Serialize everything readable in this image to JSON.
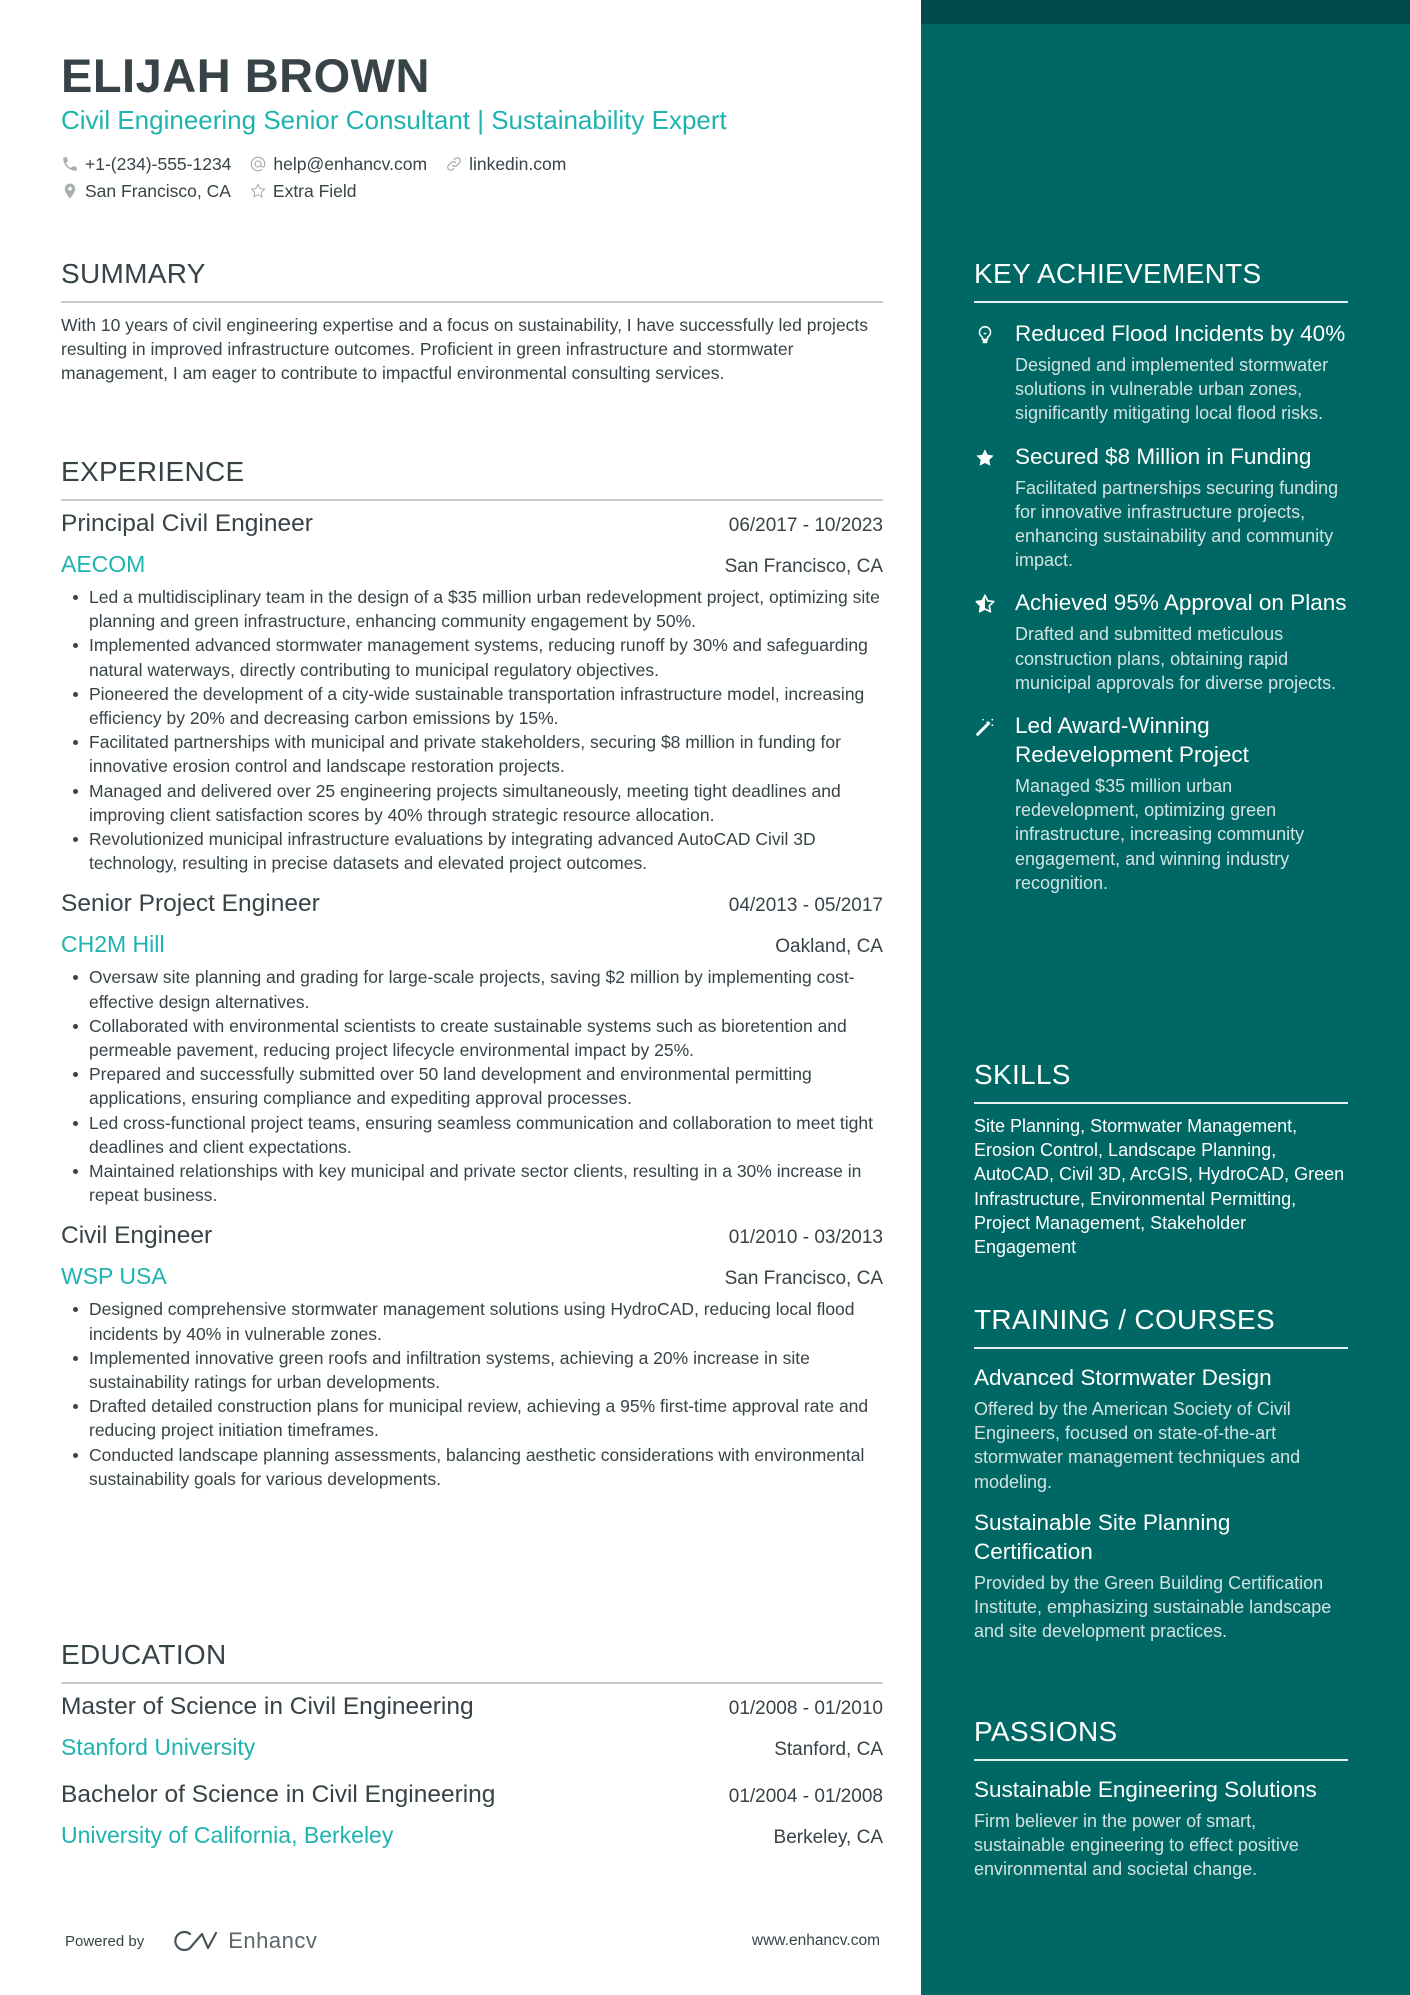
{
  "header": {
    "name": "ELIJAH BROWN",
    "subtitle": "Civil Engineering Senior Consultant | Sustainability Expert",
    "contacts": [
      {
        "icon": "phone-icon",
        "text": "+1-(234)-555-1234"
      },
      {
        "icon": "at-icon",
        "text": "help@enhancv.com"
      },
      {
        "icon": "link-icon",
        "text": "linkedin.com"
      },
      {
        "icon": "location-pin-icon",
        "text": "San Francisco, CA"
      },
      {
        "icon": "star-outline-icon",
        "text": "Extra Field"
      }
    ]
  },
  "colors": {
    "accent": "#1fb3b0",
    "text": "#384347",
    "sidebar_bg": "#006864",
    "sidebar_top": "#004b49"
  },
  "summary": {
    "title": "SUMMARY",
    "text": "With 10 years of civil engineering expertise and a focus on sustainability, I have successfully led projects resulting in improved infrastructure outcomes. Proficient in green infrastructure and stormwater management, I am eager to contribute to impactful environmental consulting services."
  },
  "experience": {
    "title": "EXPERIENCE",
    "jobs": [
      {
        "title": "Principal Civil Engineer",
        "dates": "06/2017 - 10/2023",
        "company": "AECOM",
        "location": "San Francisco, CA",
        "bullets": [
          "Led a multidisciplinary team in the design of a $35 million urban redevelopment project, optimizing site planning and green infrastructure, enhancing community engagement by 50%.",
          "Implemented advanced stormwater management systems, reducing runoff by 30% and safeguarding natural waterways, directly contributing to municipal regulatory objectives.",
          "Pioneered the development of a city-wide sustainable transportation infrastructure model, increasing efficiency by 20% and decreasing carbon emissions by 15%.",
          "Facilitated partnerships with municipal and private stakeholders, securing $8 million in funding for innovative erosion control and landscape restoration projects.",
          "Managed and delivered over 25 engineering projects simultaneously, meeting tight deadlines and improving client satisfaction scores by 40% through strategic resource allocation.",
          "Revolutionized municipal infrastructure evaluations by integrating advanced AutoCAD Civil 3D technology, resulting in precise datasets and elevated project outcomes."
        ]
      },
      {
        "title": "Senior Project Engineer",
        "dates": "04/2013 - 05/2017",
        "company": "CH2M Hill",
        "location": "Oakland, CA",
        "bullets": [
          "Oversaw site planning and grading for large-scale projects, saving $2 million by implementing cost-effective design alternatives.",
          "Collaborated with environmental scientists to create sustainable systems such as bioretention and permeable pavement, reducing project lifecycle environmental impact by 25%.",
          "Prepared and successfully submitted over 50 land development and environmental permitting applications, ensuring compliance and expediting approval processes.",
          "Led cross-functional project teams, ensuring seamless communication and collaboration to meet tight deadlines and client expectations.",
          "Maintained relationships with key municipal and private sector clients, resulting in a 30% increase in repeat business."
        ]
      },
      {
        "title": "Civil Engineer",
        "dates": "01/2010 - 03/2013",
        "company": "WSP USA",
        "location": "San Francisco, CA",
        "bullets": [
          "Designed comprehensive stormwater management solutions using HydroCAD, reducing local flood incidents by 40% in vulnerable zones.",
          "Implemented innovative green roofs and infiltration systems, achieving a 20% increase in site sustainability ratings for urban developments.",
          "Drafted detailed construction plans for municipal review, achieving a 95% first-time approval rate and reducing project initiation timeframes.",
          "Conducted landscape planning assessments, balancing aesthetic considerations with environmental sustainability goals for various developments."
        ]
      }
    ]
  },
  "education": {
    "title": "EDUCATION",
    "items": [
      {
        "degree": "Master of Science in Civil Engineering",
        "dates": "01/2008 - 01/2010",
        "school": "Stanford University",
        "location": "Stanford, CA"
      },
      {
        "degree": "Bachelor of Science in Civil Engineering",
        "dates": "01/2004 - 01/2008",
        "school": "University of California, Berkeley",
        "location": "Berkeley, CA"
      }
    ]
  },
  "footer": {
    "powered_by": "Powered by",
    "brand": "Enhancv",
    "website": "www.enhancv.com"
  },
  "sidebar": {
    "achievements": {
      "title": "KEY ACHIEVEMENTS",
      "items": [
        {
          "icon": "lightbulb-icon",
          "title": "Reduced Flood Incidents by 40%",
          "desc": "Designed and implemented stormwater solutions in vulnerable urban zones, significantly mitigating local flood risks."
        },
        {
          "icon": "star-icon",
          "title": "Secured $8 Million in Funding",
          "desc": "Facilitated partnerships securing funding for innovative infrastructure projects, enhancing sustainability and community impact."
        },
        {
          "icon": "star-half-icon",
          "title": "Achieved 95% Approval on Plans",
          "desc": "Drafted and submitted meticulous construction plans, obtaining rapid municipal approvals for diverse projects."
        },
        {
          "icon": "magic-wand-icon",
          "title": "Led Award-Winning Redevelopment Project",
          "desc": "Managed $35 million urban redevelopment, optimizing green infrastructure, increasing community engagement, and winning industry recognition."
        }
      ]
    },
    "skills": {
      "title": "SKILLS",
      "text": "Site Planning, Stormwater Management, Erosion Control, Landscape Planning, AutoCAD, Civil 3D, ArcGIS, HydroCAD, Green Infrastructure, Environmental Permitting, Project Management, Stakeholder Engagement"
    },
    "training": {
      "title": "TRAINING / COURSES",
      "items": [
        {
          "title": "Advanced Stormwater Design",
          "desc": "Offered by the American Society of Civil Engineers, focused on state-of-the-art stormwater management techniques and modeling."
        },
        {
          "title": "Sustainable Site Planning Certification",
          "desc": "Provided by the Green Building Certification Institute, emphasizing sustainable landscape and site development practices."
        }
      ]
    },
    "passions": {
      "title": "PASSIONS",
      "items": [
        {
          "title": "Sustainable Engineering Solutions",
          "desc": "Firm believer in the power of smart, sustainable engineering to effect positive environmental and societal change."
        }
      ]
    }
  }
}
